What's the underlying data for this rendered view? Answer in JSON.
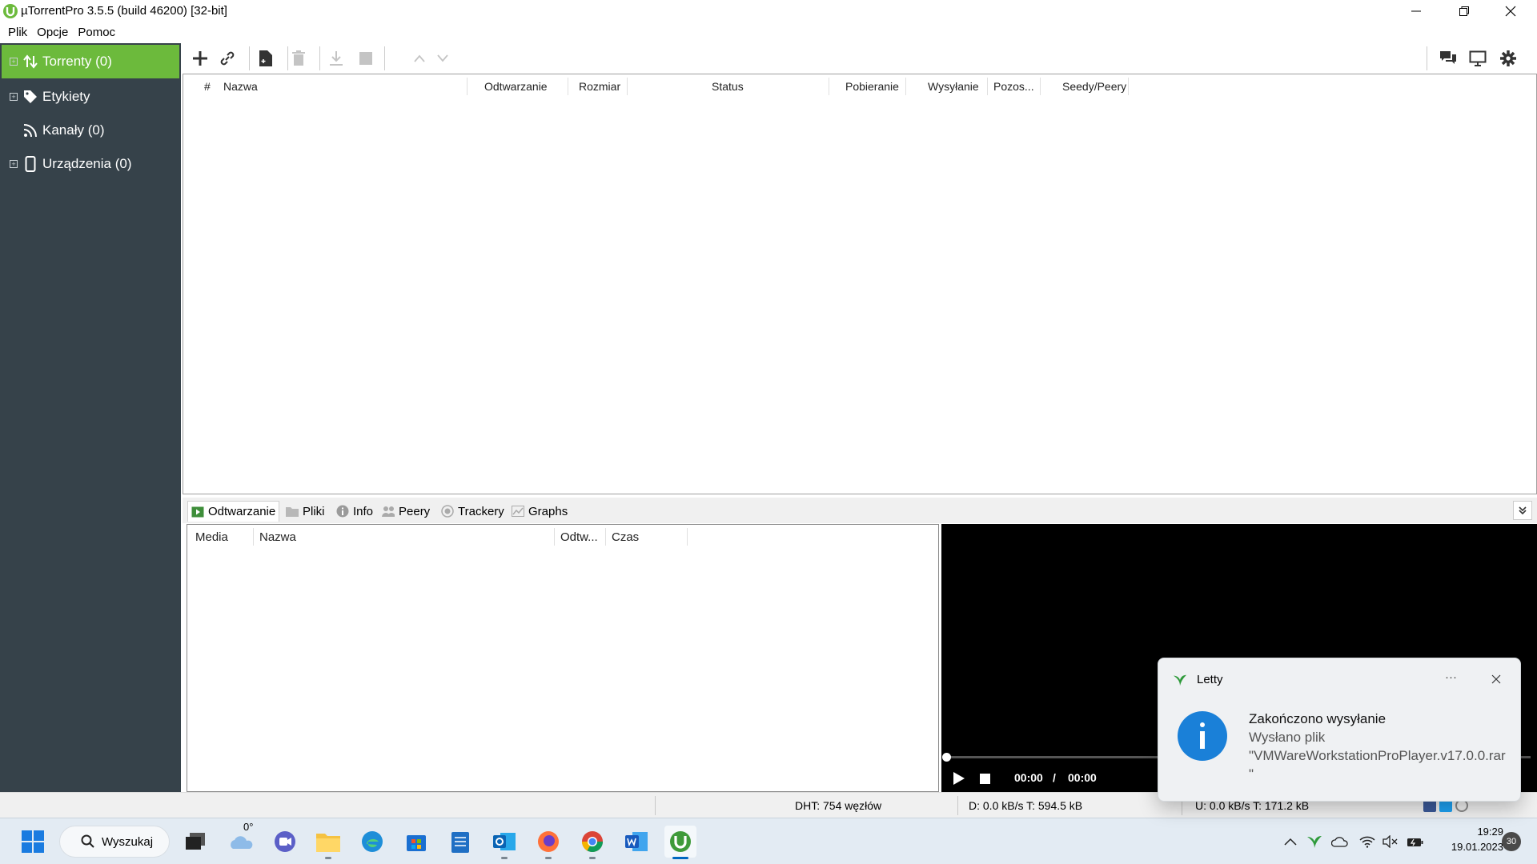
{
  "window": {
    "title": "µTorrentPro 3.5.5  (build 46200) [32-bit]",
    "controls": [
      "minimize-icon",
      "restore-icon",
      "close-icon"
    ]
  },
  "menu": {
    "file": "Plik",
    "options": "Opcje",
    "help": "Pomoc"
  },
  "sidebar": {
    "items": [
      {
        "label": "Torrenty (0)",
        "icon": "updown-arrows-icon",
        "active": true
      },
      {
        "label": "Etykiety",
        "icon": "tag-icon"
      },
      {
        "label": "Kanały (0)",
        "icon": "rss-icon"
      },
      {
        "label": "Urządzenia (0)",
        "icon": "phone-icon"
      }
    ]
  },
  "toolbar": {
    "left_icons": [
      "add-torrent-icon",
      "add-url-icon",
      "create-torrent-icon",
      "delete-icon",
      "download-icon",
      "stop-icon",
      "move-up-icon",
      "move-down-icon"
    ],
    "right_icons": [
      "chat-icon",
      "remote-icon",
      "settings-gear-icon"
    ]
  },
  "torrent_list": {
    "columns": [
      "#",
      "Nazwa",
      "Odtwarzanie",
      "Rozmiar",
      "Status",
      "Pobieranie",
      "Wysyłanie",
      "Pozos...",
      "Seedy/Peery"
    ],
    "rows": []
  },
  "detail_tabs": [
    "Odtwarzanie",
    "Pliki",
    "Info",
    "Peery",
    "Trackery",
    "Graphs"
  ],
  "playlist": {
    "columns": [
      "Media",
      "Nazwa",
      "Odtw...",
      "Czas"
    ],
    "rows": []
  },
  "player": {
    "current_time": "00:00",
    "separator": "/",
    "total_time": "00:00"
  },
  "statusbar": {
    "dht": "DHT: 754 węzłów",
    "download": "D: 0.0 kB/s T: 594.5 kB",
    "upload": "U: 0.0 kB/s T: 171.2 kB"
  },
  "taskbar": {
    "search_label": "Wyszukaj",
    "weather": "0°",
    "time": "19:29",
    "date": "19.01.2023",
    "notification_count": "30",
    "pinned_icons": [
      "task-view-icon",
      "weather-icon",
      "teams-chat-icon",
      "file-explorer-icon",
      "edge-icon",
      "store-icon",
      "notepad-icon",
      "outlook-icon",
      "firefox-icon",
      "chrome-icon",
      "word-icon",
      "utorrent-icon"
    ],
    "tray_icons": [
      "chevron-up-icon",
      "letty-tray-icon",
      "onedrive-icon",
      "wifi-icon",
      "volume-muted-icon",
      "battery-icon"
    ]
  },
  "toast": {
    "app": "Letty",
    "title": "Zakończono wysyłanie",
    "line1": "Wysłano plik",
    "line2": "\"VMWareWorkstationProPlayer.v17.0.0.rar",
    "line3": "\"",
    "more": "···"
  },
  "colors": {
    "sidebar_bg": "#36424a",
    "sidebar_active": "#6cba3c",
    "info_blue": "#1a80d8",
    "taskbar_bg": "#e3ebf3"
  }
}
